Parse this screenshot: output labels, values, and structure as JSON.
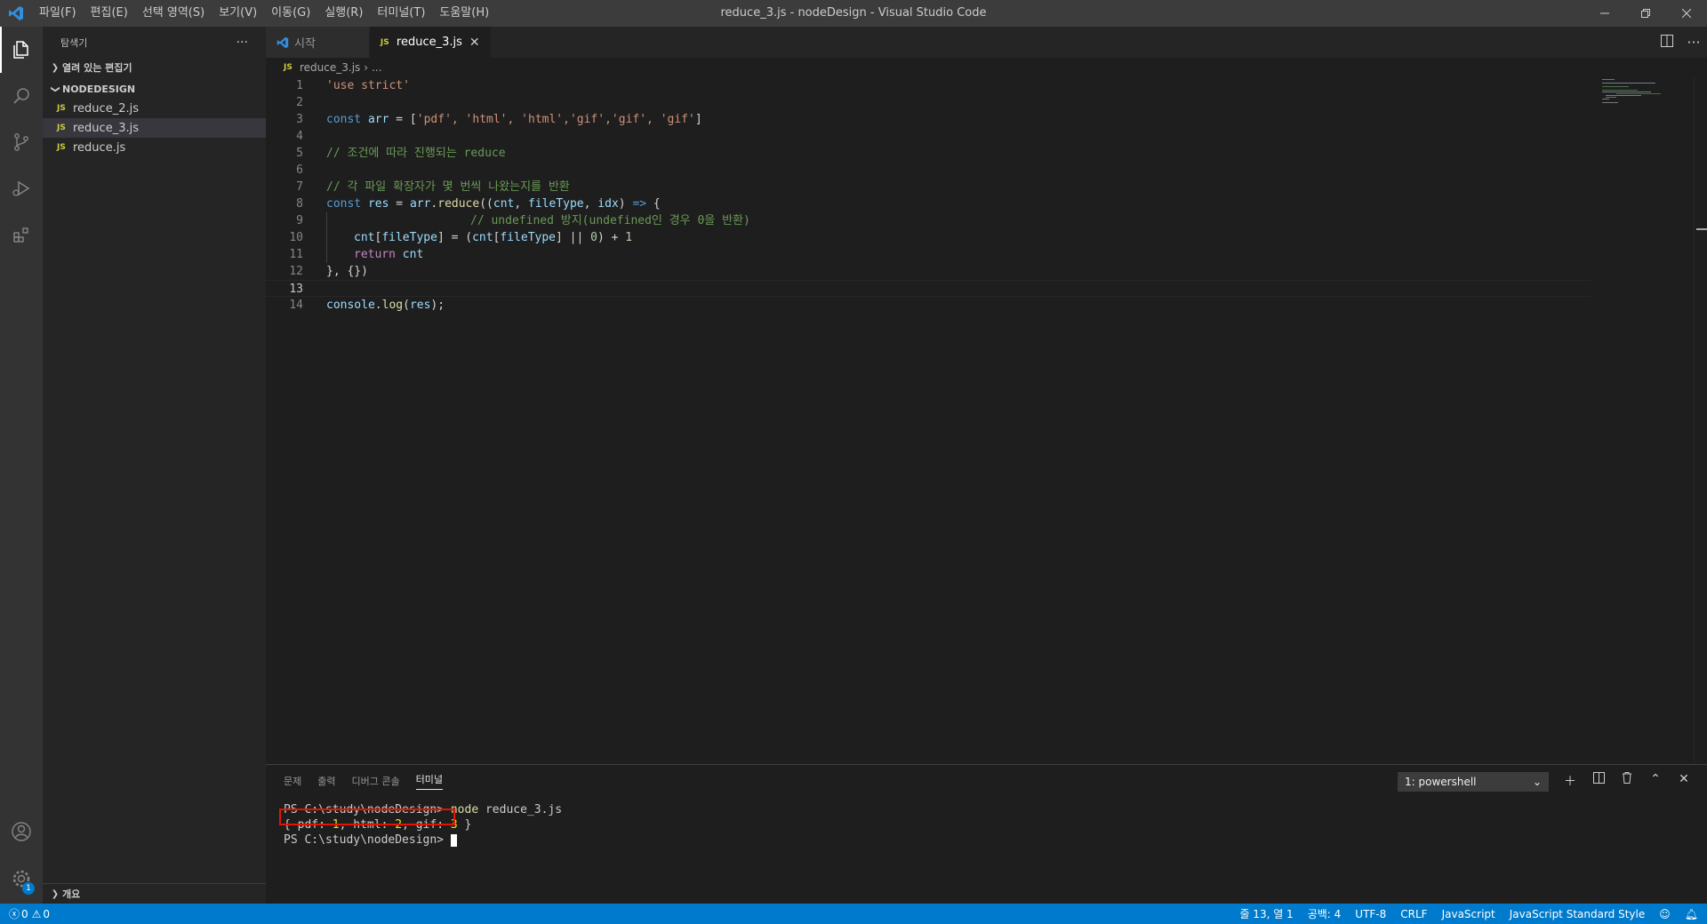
{
  "window": {
    "title": "reduce_3.js - nodeDesign - Visual Studio Code",
    "menus": [
      "파일(F)",
      "편집(E)",
      "선택 영역(S)",
      "보기(V)",
      "이동(G)",
      "실행(R)",
      "터미널(T)",
      "도움말(H)"
    ]
  },
  "sidebar": {
    "title": "탐색기",
    "open_editors": "열려 있는 편집기",
    "folder": "NODEDESIGN",
    "files": [
      "reduce_2.js",
      "reduce_3.js",
      "reduce.js"
    ],
    "file_badge": "JS",
    "outline": "개요"
  },
  "tabs": [
    {
      "label": "시작"
    },
    {
      "label": "reduce_3.js"
    }
  ],
  "breadcrumb": {
    "file": "reduce_3.js",
    "rest": "..."
  },
  "editor": {
    "line_numbers": [
      "1",
      "2",
      "3",
      "4",
      "5",
      "6",
      "7",
      "8",
      "9",
      "10",
      "11",
      "12",
      "13",
      "14"
    ],
    "l1": "'use strict'",
    "l3_const": "const",
    "l3_var": "arr",
    "l3_eq": " = [",
    "l3_strs": "'pdf', 'html', 'html','gif','gif', 'gif'",
    "l3_end": "]",
    "l5": "// 조건에 따라 진행되는 reduce",
    "l7": "// 각 파일 확장자가 몇 번씩 나왔는지를 반환",
    "l8_const": "const",
    "l8_res": "res",
    "l8_eq": " = ",
    "l8_arr": "arr",
    "l8_dot": ".",
    "l8_fn": "reduce",
    "l8_open": "((",
    "l8_cnt": "cnt",
    "l8_comma1": ", ",
    "l8_ft": "fileType",
    "l8_comma2": ", ",
    "l8_idx": "idx",
    "l8_close": ") ",
    "l8_arrow": "=>",
    "l8_brace": " {",
    "l9": "// undefined 방지(undefined인 경우 0을 반환)",
    "l10_a": "cnt",
    "l10_b": "[",
    "l10_c": "fileType",
    "l10_d": "] = (",
    "l10_e": "cnt",
    "l10_f": "[",
    "l10_g": "fileType",
    "l10_h": "] || ",
    "l10_i": "0",
    "l10_j": ") + ",
    "l10_k": "1",
    "l11_ret": "return",
    "l11_cnt": "cnt",
    "l12": "}, {})",
    "l14_console": "console",
    "l14_dot": ".",
    "l14_log": "log",
    "l14_open": "(",
    "l14_res": "res",
    "l14_end": ");"
  },
  "panel": {
    "tabs": [
      "문제",
      "출력",
      "디버그 콘솔",
      "터미널"
    ],
    "terminal_select": "1: powershell",
    "t1_prompt": "PS C:\\study\\nodeDesign> ",
    "t1_cmd": "node",
    "t1_arg": " reduce_3.js",
    "t2_open": "{ pdf: ",
    "t2_pdf": "1",
    "t2_html_lbl": ", html: ",
    "t2_html": "2",
    "t2_gif_lbl": ", gif: ",
    "t2_gif": "3",
    "t2_close": " }",
    "t3_prompt": "PS C:\\study\\nodeDesign> "
  },
  "status": {
    "errors": "0",
    "warnings": "0",
    "position": "줄 13, 열 1",
    "spaces": "공백: 4",
    "encoding": "UTF-8",
    "eol": "CRLF",
    "language": "JavaScript",
    "linter": "JavaScript Standard Style"
  },
  "badges": {
    "settings": "1"
  },
  "colors": {
    "accent": "#007acc",
    "highlight": "#e51400"
  }
}
